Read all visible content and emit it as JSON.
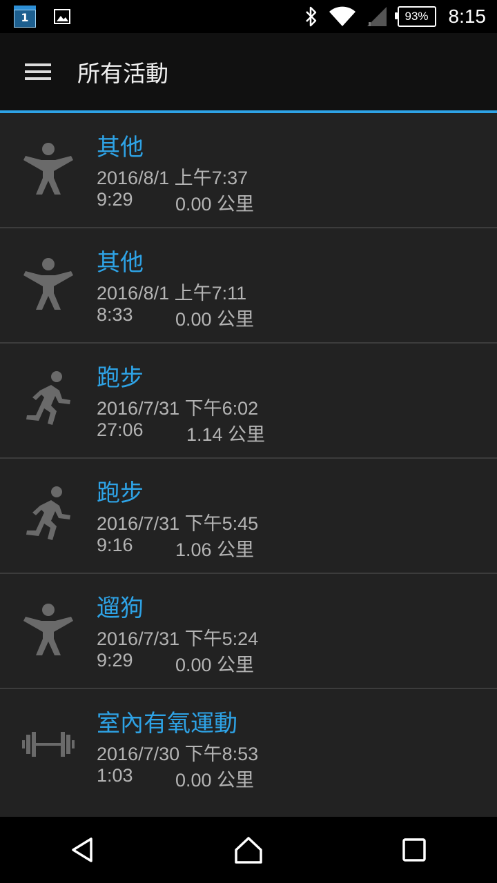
{
  "status_bar": {
    "calendar_day": "1",
    "battery": "93%",
    "time": "8:15",
    "icons": [
      "calendar-icon",
      "image-icon",
      "bluetooth-icon",
      "wifi-icon",
      "signal-icon",
      "battery-icon"
    ]
  },
  "app_bar": {
    "title": "所有活動",
    "menu_icon": "hamburger-menu-icon"
  },
  "colors": {
    "accent": "#2ea3e6",
    "background": "#222222",
    "app_bar": "#111111",
    "secondary_text": "#b4b4b4",
    "icon_gray": "#6a6a6a"
  },
  "activities": [
    {
      "name": "其他",
      "date": "2016/8/1 上午7:37",
      "duration": "9:29",
      "distance": "0.00 公里",
      "icon": "person-icon"
    },
    {
      "name": "其他",
      "date": "2016/8/1 上午7:11",
      "duration": "8:33",
      "distance": "0.00 公里",
      "icon": "person-icon"
    },
    {
      "name": "跑步",
      "date": "2016/7/31 下午6:02",
      "duration": "27:06",
      "distance": "1.14 公里",
      "icon": "running-icon"
    },
    {
      "name": "跑步",
      "date": "2016/7/31 下午5:45",
      "duration": "9:16",
      "distance": "1.06 公里",
      "icon": "running-icon"
    },
    {
      "name": "遛狗",
      "date": "2016/7/31 下午5:24",
      "duration": "9:29",
      "distance": "0.00 公里",
      "icon": "person-icon"
    },
    {
      "name": "室內有氧運動",
      "date": "2016/7/30 下午8:53",
      "duration": "1:03",
      "distance": "0.00 公里",
      "icon": "dumbbell-icon"
    }
  ],
  "nav_bar": {
    "icons": [
      "back-icon",
      "home-icon",
      "recents-icon"
    ]
  }
}
